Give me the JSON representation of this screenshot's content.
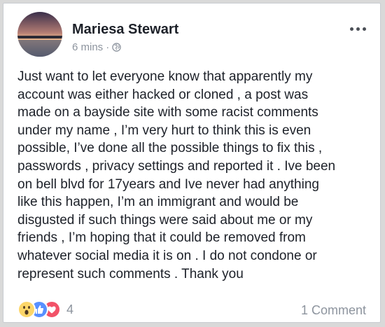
{
  "post": {
    "author": "Mariesa Stewart",
    "time": "6 mins",
    "separator": "·",
    "privacy_icon": "globe-icon",
    "text": "Just want to let everyone know that apparently my\naccount was either hacked or cloned , a post was\nmade on a bayside site with some racist comments\nunder my name , I’m very hurt to think this is even\npossible, I’ve done all the possible things to fix this ,\npasswords , privacy settings and reported it . Ive been\non bell blvd for 17years and Ive never had anything\nlike this happen, I’m an immigrant and would be\ndisgusted if such things were said about me or my\nfriends , I’m hoping that it could be removed from\nwhatever social media it is on . I do not condone or\nrepresent such comments . Thank you"
  },
  "footer": {
    "reactions": [
      "wow-icon",
      "like-icon",
      "love-icon"
    ],
    "reaction_count": "4",
    "comments_label": "1 Comment"
  },
  "colors": {
    "text": "#1d2129",
    "muted": "#8d949e",
    "like": "#5890ff",
    "love": "#f25268",
    "wow": "#fcd669"
  }
}
